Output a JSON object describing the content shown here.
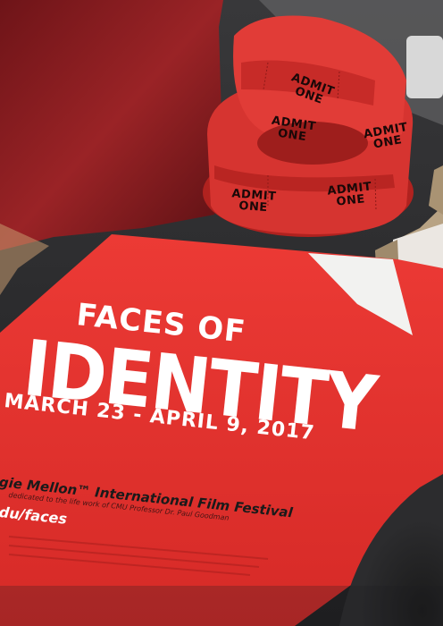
{
  "poster": {
    "line1": "FACES OF",
    "line2": "IDENTITY",
    "dates": "MARCH 23 - APRIL 9, 2017",
    "festival": "gie Mellon™ International Film Festival",
    "dedication": "dedicated to the life work of CMU Professor Dr. Paul Goodman",
    "url": "du/faces"
  },
  "tickets": {
    "label": "ADMIT ONE"
  },
  "colors": {
    "poster_red": "#e8322f",
    "ticket_red": "#d9302c",
    "table_dark": "#2a2a2c",
    "cloth_red": "#8a1c1f"
  }
}
